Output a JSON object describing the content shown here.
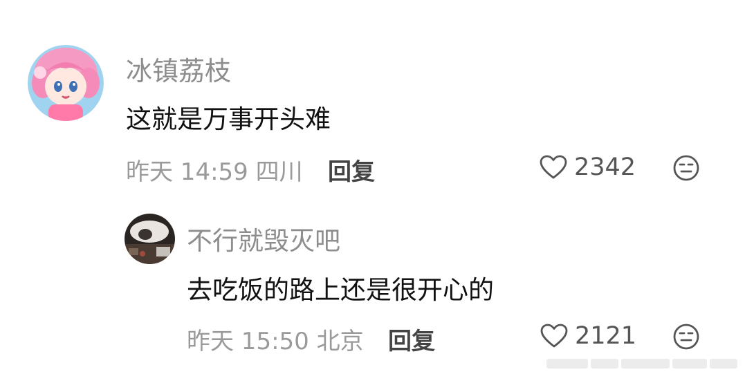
{
  "comments": [
    {
      "username": "冰镇荔枝",
      "text": "这就是万事开头难",
      "time": "昨天 14:59",
      "location": "四川",
      "meta": "昨天 14:59 四川",
      "reply_label": "回复",
      "likes": "2342",
      "like_icon": "heart-icon",
      "dislike_icon": "neutral-face-icon"
    },
    {
      "username": "不行就毁灭吧",
      "text": "去吃饭的路上还是很开心的",
      "time": "昨天 15:50",
      "location": "北京",
      "meta": "昨天 15:50 北京",
      "reply_label": "回复",
      "likes": "2121",
      "like_icon": "heart-icon",
      "dislike_icon": "neutral-face-icon"
    }
  ],
  "colors": {
    "username": "#8d8d8d",
    "text": "#111111",
    "meta": "#9a9a9a",
    "reply": "#444444",
    "icon": "#555555"
  }
}
